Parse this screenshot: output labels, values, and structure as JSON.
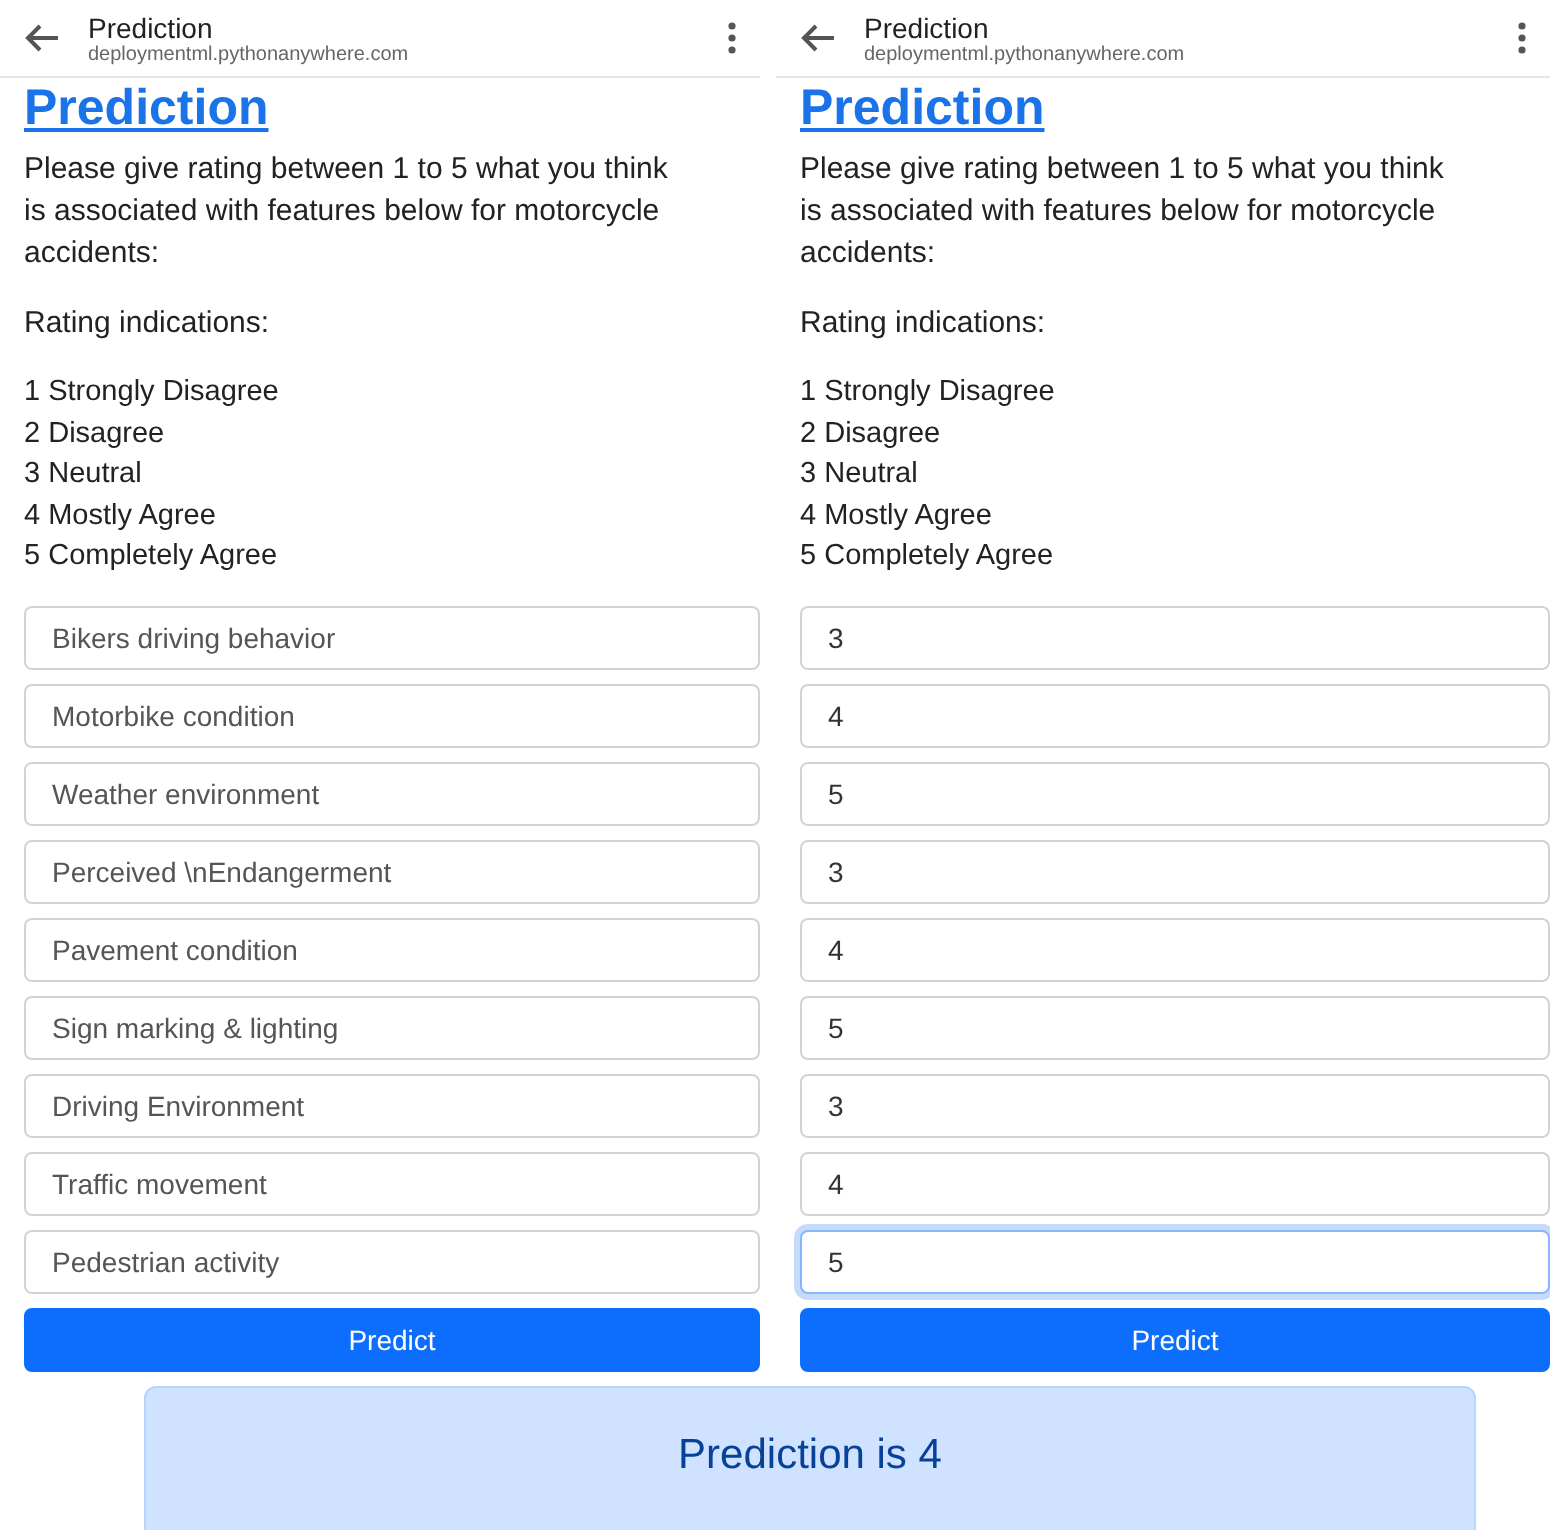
{
  "screens": [
    {
      "title": "Prediction",
      "url": "deploymentml.pythonanywhere.com",
      "heading": "Prediction",
      "intro": "Please give rating between 1 to 5 what you think is associated with features below for motorcycle accidents:",
      "rating_label": "Rating indications:",
      "ratings": [
        "1 Strongly Disagree",
        "2 Disagree",
        "3 Neutral",
        "4 Mostly Agree",
        "5 Completely Agree"
      ],
      "fields": [
        {
          "placeholder": "Bikers driving behavior",
          "focused": false
        },
        {
          "placeholder": "Motorbike condition",
          "focused": false
        },
        {
          "placeholder": "Weather environment",
          "focused": false
        },
        {
          "placeholder": "Perceived \\nEndangerment",
          "focused": false
        },
        {
          "placeholder": "Pavement condition",
          "focused": false
        },
        {
          "placeholder": "Sign marking & lighting",
          "focused": false
        },
        {
          "placeholder": "Driving Environment",
          "focused": false
        },
        {
          "placeholder": "Traffic movement",
          "focused": false
        },
        {
          "placeholder": "Pedestrian activity",
          "focused": false
        }
      ],
      "button": "Predict"
    },
    {
      "title": "Prediction",
      "url": "deploymentml.pythonanywhere.com",
      "heading": "Prediction",
      "intro": "Please give rating between 1 to 5 what you think is associated with features below for motorcycle accidents:",
      "rating_label": "Rating indications:",
      "ratings": [
        "1 Strongly Disagree",
        "2 Disagree",
        "3 Neutral",
        "4 Mostly Agree",
        "5 Completely Agree"
      ],
      "fields": [
        {
          "value": "3",
          "focused": false
        },
        {
          "value": "4",
          "focused": false
        },
        {
          "value": "5",
          "focused": false
        },
        {
          "value": "3",
          "focused": false
        },
        {
          "value": "4",
          "focused": false
        },
        {
          "value": "5",
          "focused": false
        },
        {
          "value": "3",
          "focused": false
        },
        {
          "value": "4",
          "focused": false
        },
        {
          "value": "5",
          "focused": true
        }
      ],
      "button": "Predict"
    }
  ],
  "result": "Prediction is 4"
}
